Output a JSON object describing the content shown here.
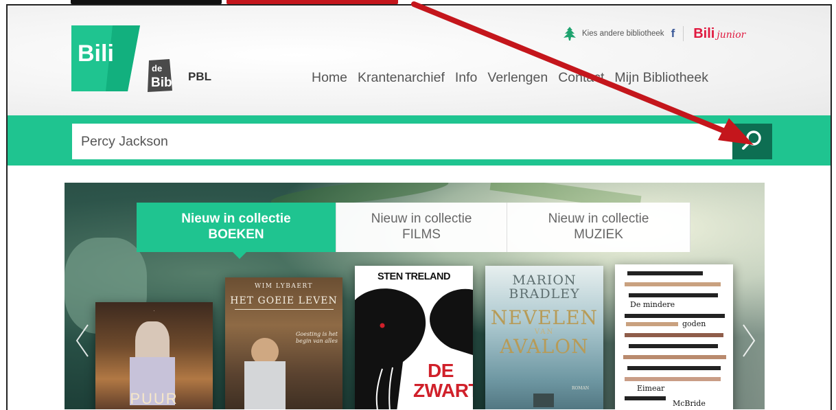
{
  "header": {
    "logo_text": "Bili",
    "sublogo_text": "de Bib",
    "library_code": "PBL",
    "choose_library": "Kies andere bibliotheek",
    "facebook_label": "f",
    "bili_junior_brand": "Bili",
    "bili_junior_suffix": "junior"
  },
  "nav": {
    "items": [
      "Home",
      "Krantenarchief",
      "Info",
      "Verlengen",
      "Contact",
      "Mijn Bibliotheek"
    ]
  },
  "search": {
    "value": "Percy Jackson",
    "placeholder": "Percy Jackson"
  },
  "tabs": [
    {
      "line1": "Nieuw in collectie",
      "line2": "BOEKEN",
      "active": true
    },
    {
      "line1": "Nieuw in collectie",
      "line2": "FILMS",
      "active": false
    },
    {
      "line1": "Nieuw in collectie",
      "line2": "MUZIEK",
      "active": false
    }
  ],
  "books": [
    {
      "bottom_text": "PUUR"
    },
    {
      "author": "WIM LYBAERT",
      "title": "HET GOEIE LEVEN",
      "tagline": "Goesting is het begin van alles"
    },
    {
      "author": "STEN TRELAND",
      "title_line1": "DE",
      "title_line2": "ZWARTE"
    },
    {
      "author_line1": "MARION",
      "author_line2": "BRADLEY",
      "title_line1": "NEVELEN",
      "title_van": "VAN",
      "title_line2": "AVALON",
      "imprint": "ROMAN"
    },
    {
      "title_line1": "De mindere",
      "title_line2": "goden",
      "author_line1": "Eimear",
      "author_line2": "McBride"
    }
  ],
  "colors": {
    "brand_green": "#1fc490",
    "search_button": "#0d6e52",
    "annotation_red": "#c4161c",
    "junior_red": "#e0193f"
  },
  "icons": {
    "search": "magnifier-icon",
    "tree": "tree-icon",
    "prev": "chevron-left-icon",
    "next": "chevron-right-icon"
  }
}
